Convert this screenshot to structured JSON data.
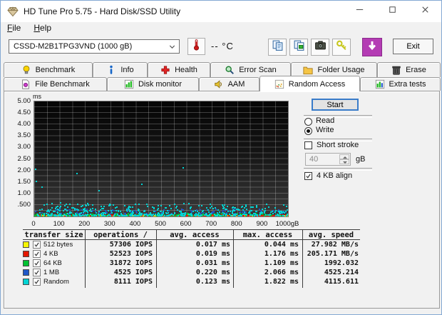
{
  "window": {
    "title": "HD Tune Pro 5.75 - Hard Disk/SSD Utility",
    "app_icon": "gem-icon",
    "controls": [
      {
        "name": "minimize-button",
        "icon": "minimize-icon"
      },
      {
        "name": "maximize-button",
        "icon": "maximize-icon"
      },
      {
        "name": "close-button",
        "icon": "close-icon"
      }
    ]
  },
  "menu": {
    "items": [
      {
        "label": "File"
      },
      {
        "label": "Help"
      }
    ]
  },
  "toolbar": {
    "drive_select": {
      "value": "CSSD-M2B1TPG3VND (1000 gB)",
      "chevron_icon": "chevron-down-icon"
    },
    "temperature": {
      "value": "--",
      "unit": "°C",
      "icon": "thermometer-icon"
    },
    "buttons": [
      {
        "name": "copy-clipboard-button",
        "icon": "copy-icon"
      },
      {
        "name": "copy-file-button",
        "icon": "copy-file-icon"
      },
      {
        "name": "screenshot-button",
        "icon": "camera-icon"
      },
      {
        "name": "options-button",
        "icon": "keys-icon"
      },
      {
        "name": "download-button",
        "icon": "download-icon"
      }
    ],
    "exit_label": "Exit"
  },
  "tabs": {
    "active_tab": "Random Access",
    "row1": [
      {
        "label": "Benchmark",
        "icon": "lamp-icon"
      },
      {
        "label": "Info",
        "icon": "info-icon"
      },
      {
        "label": "Health",
        "icon": "health-icon"
      },
      {
        "label": "Error Scan",
        "icon": "magnifier-icon"
      },
      {
        "label": "Folder Usage",
        "icon": "folder-icon"
      },
      {
        "label": "Erase",
        "icon": "trash-icon"
      }
    ],
    "row2": [
      {
        "label": "File Benchmark",
        "icon": "file-benchmark-icon"
      },
      {
        "label": "Disk monitor",
        "icon": "disk-monitor-icon"
      },
      {
        "label": "AAM",
        "icon": "speaker-icon"
      },
      {
        "label": "Random Access",
        "icon": "random-access-icon",
        "active": true
      },
      {
        "label": "Extra tests",
        "icon": "extra-tests-icon"
      }
    ]
  },
  "controls_panel": {
    "start_label": "Start",
    "read": {
      "label": "Read",
      "selected": false
    },
    "write": {
      "label": "Write",
      "selected": true
    },
    "short_stroke": {
      "label": "Short stroke",
      "checked": false
    },
    "stroke_size": {
      "value": "40",
      "unit": "gB",
      "enabled": false
    },
    "align": {
      "label": "4 KB align",
      "checked": true
    }
  },
  "chart_data": {
    "type": "scatter",
    "title": "Random access time vs disk position",
    "xlabel": "gB",
    "ylabel": "ms",
    "xlim": [
      0,
      1000
    ],
    "ylim": [
      0,
      5
    ],
    "x_tick_labels": [
      "0",
      "100",
      "200",
      "300",
      "400",
      "500",
      "600",
      "700",
      "800",
      "900",
      "1000gB"
    ],
    "y_tick_labels": [
      "5.00",
      "4.50",
      "4.00",
      "3.50",
      "3.00",
      "2.50",
      "2.00",
      "1.50",
      "1.00",
      ".500"
    ],
    "grid": {
      "x_step": 50,
      "y_step": 0.25
    },
    "series": [
      {
        "name": "512 bytes",
        "color": "#f0ee00",
        "band": [
          0.01,
          0.05
        ],
        "bias": 1.0,
        "count": 270
      },
      {
        "name": "4 KB",
        "color": "#e41800",
        "band": [
          0.01,
          0.06
        ],
        "bias": 1.0,
        "count": 270
      },
      {
        "name": "64 KB",
        "color": "#00c232",
        "band": [
          0.02,
          0.12
        ],
        "bias": 1.6,
        "count": 230
      },
      {
        "name": "1 MB",
        "color": "#2058c8",
        "band": [
          0.1,
          0.32
        ],
        "bias": 1.2,
        "count": 110
      },
      {
        "name": "Random",
        "color": "#00d4d4",
        "band": [
          0.04,
          0.55
        ],
        "bias": 2.4,
        "count": 520
      }
    ],
    "outliers": [
      {
        "x": 5,
        "y": 2.05,
        "color": "#00d4d4"
      },
      {
        "x": 9,
        "y": 1.52,
        "color": "#00d4d4"
      },
      {
        "x": 32,
        "y": 1.27,
        "color": "#00d4d4"
      },
      {
        "x": 70,
        "y": 0.55,
        "color": "#00d4d4"
      },
      {
        "x": 105,
        "y": 0.58,
        "color": "#00d4d4"
      },
      {
        "x": 168,
        "y": 1.87,
        "color": "#00d4d4"
      },
      {
        "x": 212,
        "y": 0.57,
        "color": "#00d4d4"
      },
      {
        "x": 257,
        "y": 1.13,
        "color": "#00d4d4"
      },
      {
        "x": 300,
        "y": 0.5,
        "color": "#00d4d4"
      },
      {
        "x": 424,
        "y": 1.4,
        "color": "#00d4d4"
      },
      {
        "x": 586,
        "y": 2.1,
        "color": "#00d4d4"
      },
      {
        "x": 648,
        "y": 0.46,
        "color": "#00d4d4"
      },
      {
        "x": 833,
        "y": 0.42,
        "color": "#00d4d4"
      }
    ]
  },
  "table": {
    "headers": [
      "transfer size",
      "operations /",
      "avg. access",
      "max. access",
      "avg. speed"
    ],
    "rows": [
      {
        "color": "#f5f500",
        "checked": true,
        "label": "512 bytes",
        "operations": "57306 IOPS",
        "avg_access": "0.017 ms",
        "max_access": "0.044 ms",
        "avg_speed": "27.982 MB/s"
      },
      {
        "color": "#e41800",
        "checked": true,
        "label": "4 KB",
        "operations": "52523 IOPS",
        "avg_access": "0.019 ms",
        "max_access": "1.176 ms",
        "avg_speed": "205.171 MB/s"
      },
      {
        "color": "#00c232",
        "checked": true,
        "label": "64 KB",
        "operations": "31872 IOPS",
        "avg_access": "0.031 ms",
        "max_access": "1.109 ms",
        "avg_speed": "1992.032"
      },
      {
        "color": "#2058c8",
        "checked": true,
        "label": "1 MB",
        "operations": "4525 IOPS",
        "avg_access": "0.220 ms",
        "max_access": "2.066 ms",
        "avg_speed": "4525.214"
      },
      {
        "color": "#00d4d4",
        "checked": true,
        "label": "Random",
        "operations": "8111 IOPS",
        "avg_access": "0.123 ms",
        "max_access": "1.822 ms",
        "avg_speed": "4115.611"
      }
    ]
  }
}
